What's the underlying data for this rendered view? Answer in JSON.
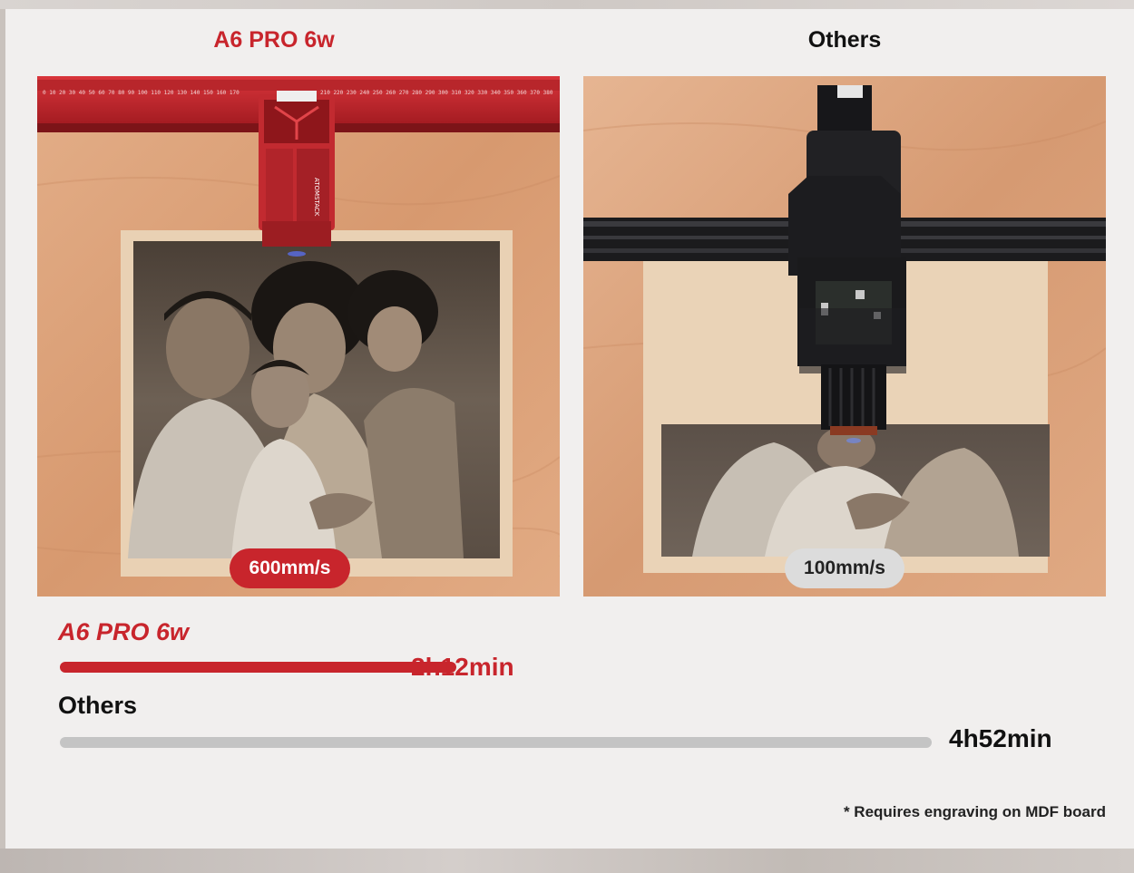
{
  "columns": {
    "left_title": "A6 PRO 6w",
    "right_title": "Others"
  },
  "photos": {
    "left_speed": "600mm/s",
    "right_speed": "100mm/s",
    "left_machine_logo": "ATOMSTACK"
  },
  "comparison": {
    "a6": {
      "label": "A6 PRO 6w",
      "time": "2h12min",
      "fraction_of_max": 0.455
    },
    "others": {
      "label": "Others",
      "time": "4h52min",
      "fraction_of_max": 1.0
    }
  },
  "footnote": "* Requires engraving on MDF board",
  "colors": {
    "accent_red": "#c8252c",
    "bar_gray": "#c4c4c4",
    "background": "#f1efee"
  }
}
